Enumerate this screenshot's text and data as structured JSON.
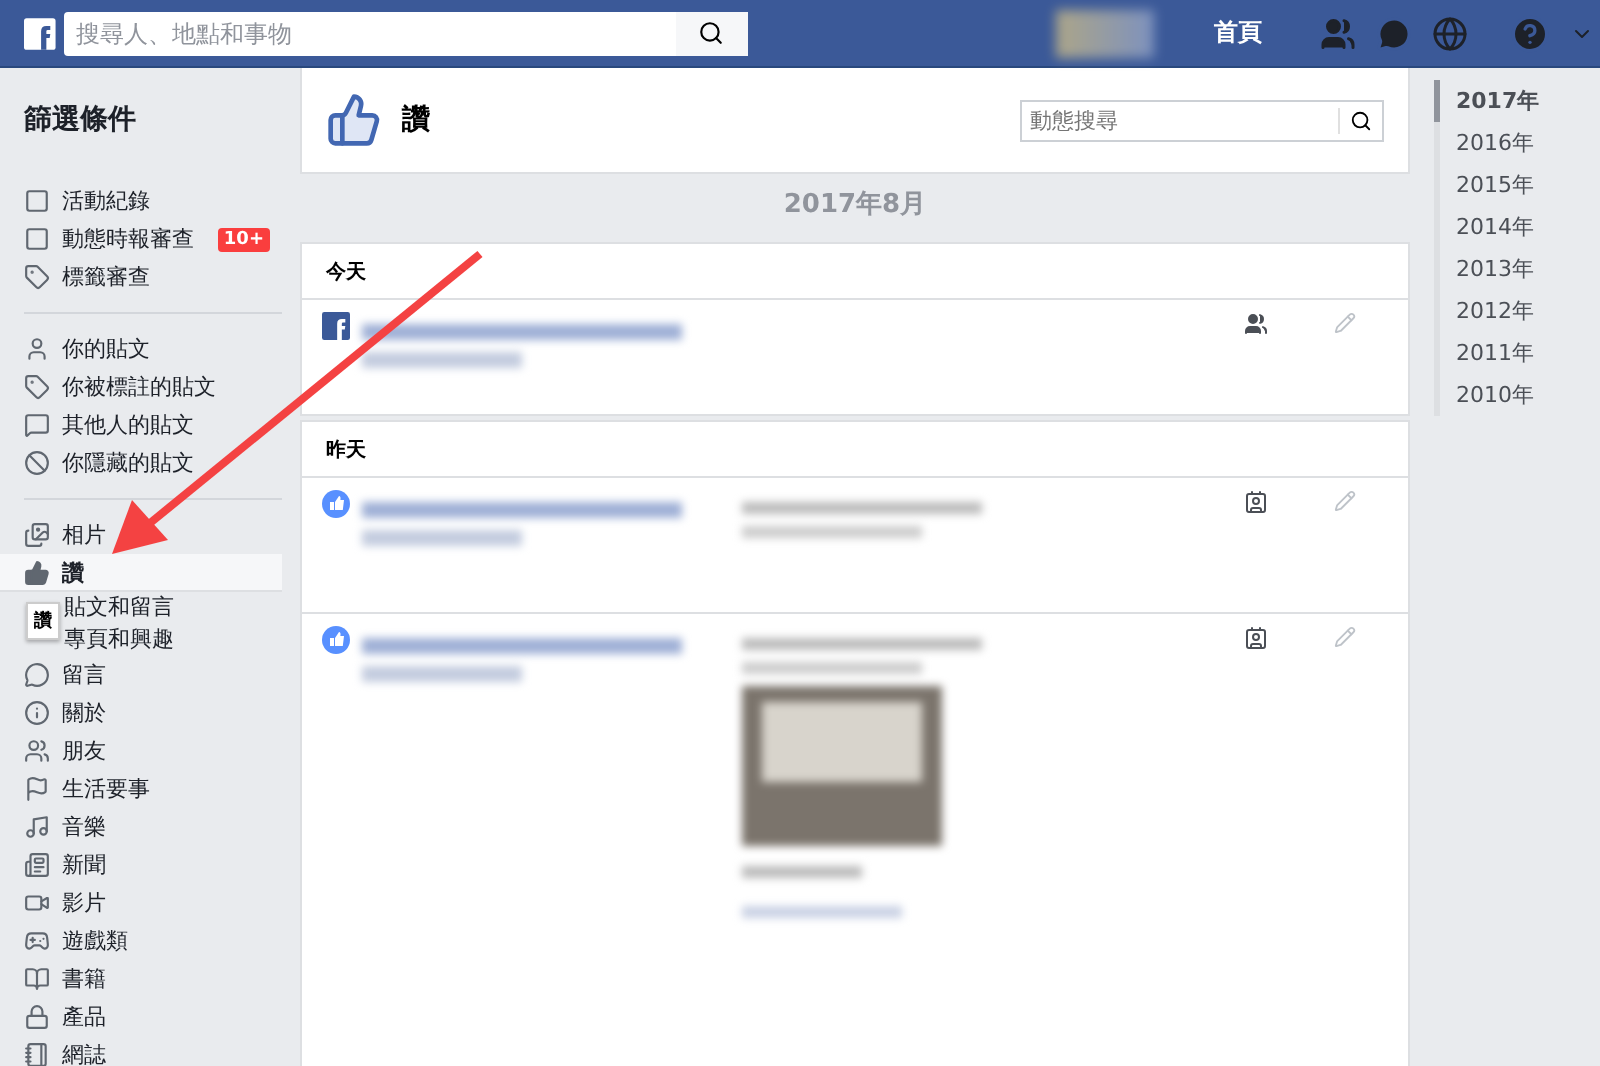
{
  "header": {
    "search": {
      "placeholder": "搜尋人、地點和事物"
    },
    "nav": [
      "首頁"
    ]
  },
  "sidebar": {
    "title": "篩選條件",
    "groups": [
      [
        {
          "label": "活動紀錄",
          "selected": false
        },
        {
          "label": "動態時報審查",
          "selected": false,
          "badge": "10+"
        },
        {
          "label": "標籤審查",
          "selected": false
        }
      ],
      [
        {
          "label": "你的貼文",
          "selected": false
        },
        {
          "label": "你被標註的貼文",
          "selected": false
        },
        {
          "label": "其他人的貼文",
          "selected": false
        },
        {
          "label": "你隱藏的貼文",
          "selected": false
        }
      ],
      [
        {
          "label": "相片",
          "selected": false
        },
        {
          "label": "讚",
          "selected": true,
          "children": [
            {
              "label": "貼文和留言"
            },
            {
              "label": "專頁和興趣"
            }
          ]
        },
        {
          "label": "留言",
          "selected": false
        },
        {
          "label": "關於",
          "selected": false
        },
        {
          "label": "朋友",
          "selected": false
        },
        {
          "label": "生活要事",
          "selected": false
        },
        {
          "label": "音樂",
          "selected": false
        },
        {
          "label": "新聞",
          "selected": false
        },
        {
          "label": "影片",
          "selected": false
        },
        {
          "label": "遊戲類",
          "selected": false
        },
        {
          "label": "書籍",
          "selected": false
        },
        {
          "label": "產品",
          "selected": false
        },
        {
          "label": "網誌",
          "selected": false
        }
      ]
    ]
  },
  "tooltip": "讚",
  "main": {
    "title": "讚",
    "search": {
      "placeholder": "動態搜尋"
    },
    "month": "2017年8月",
    "sections": [
      {
        "label": "今天",
        "entries": [
          {
            "kind": "page",
            "friends_audience": true,
            "photo": false
          }
        ]
      },
      {
        "label": "昨天",
        "entries": [
          {
            "kind": "like",
            "friends_audience": false,
            "photo": false
          },
          {
            "kind": "like",
            "friends_audience": false,
            "photo": true
          }
        ]
      }
    ]
  },
  "years": [
    {
      "label": "2017年",
      "selected": true
    },
    {
      "label": "2016年",
      "selected": false
    },
    {
      "label": "2015年",
      "selected": false
    },
    {
      "label": "2014年",
      "selected": false
    },
    {
      "label": "2013年",
      "selected": false
    },
    {
      "label": "2012年",
      "selected": false
    },
    {
      "label": "2011年",
      "selected": false
    },
    {
      "label": "2010年",
      "selected": false
    }
  ]
}
